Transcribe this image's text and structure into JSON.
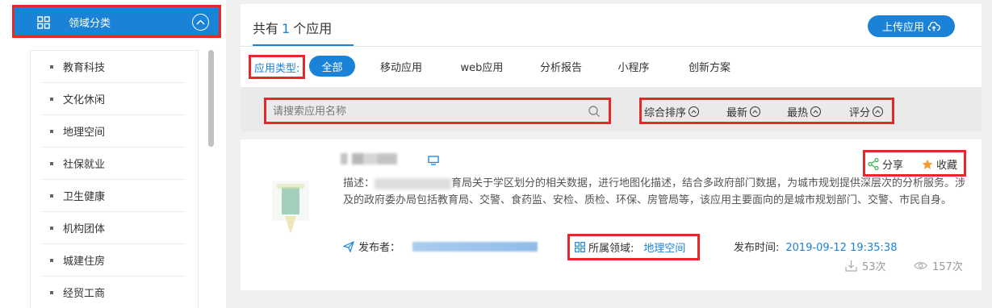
{
  "sidebar": {
    "title": "领域分类",
    "items": [
      {
        "label": "教育科技"
      },
      {
        "label": "文化休闲"
      },
      {
        "label": "地理空间"
      },
      {
        "label": "社保就业"
      },
      {
        "label": "卫生健康"
      },
      {
        "label": "机构团体"
      },
      {
        "label": "城建住房"
      },
      {
        "label": "经贸工商"
      }
    ]
  },
  "header": {
    "count_prefix": "共有",
    "count": "1",
    "count_suffix": "个应用",
    "upload_label": "上传应用"
  },
  "filters": {
    "type_label": "应用类型:",
    "types": [
      "全部",
      "移动应用",
      "web应用",
      "分析报告",
      "小程序",
      "创新方案"
    ],
    "active_type": "全部",
    "search_placeholder": "请搜索应用名称",
    "sorts": [
      "综合排序",
      "最新",
      "最热",
      "评分"
    ]
  },
  "app": {
    "description_label": "描述：",
    "description_line1_tail": "育局关于学区划分的相关数据，进行地图化描述，结合多政府部门数据，为城市规划提供深层次的分析",
    "description_rest": "服务。涉及的政府委办局包括教育局、交警、食药监、安检、质检、环保、房管局等，该应用主要面向的是城市规划部门、交警、市民自身。",
    "share_label": "分享",
    "favorite_label": "收藏",
    "publisher_label": "发布者：",
    "domain_label": "所属领域:",
    "domain_value": "地理空间",
    "publish_time_label": "发布时间:",
    "publish_time_value": "2019-09-12 19:35:38",
    "downloads": "53次",
    "views": "157次"
  },
  "colors": {
    "accent": "#1a83d8",
    "highlight_border": "#e32a2a"
  }
}
